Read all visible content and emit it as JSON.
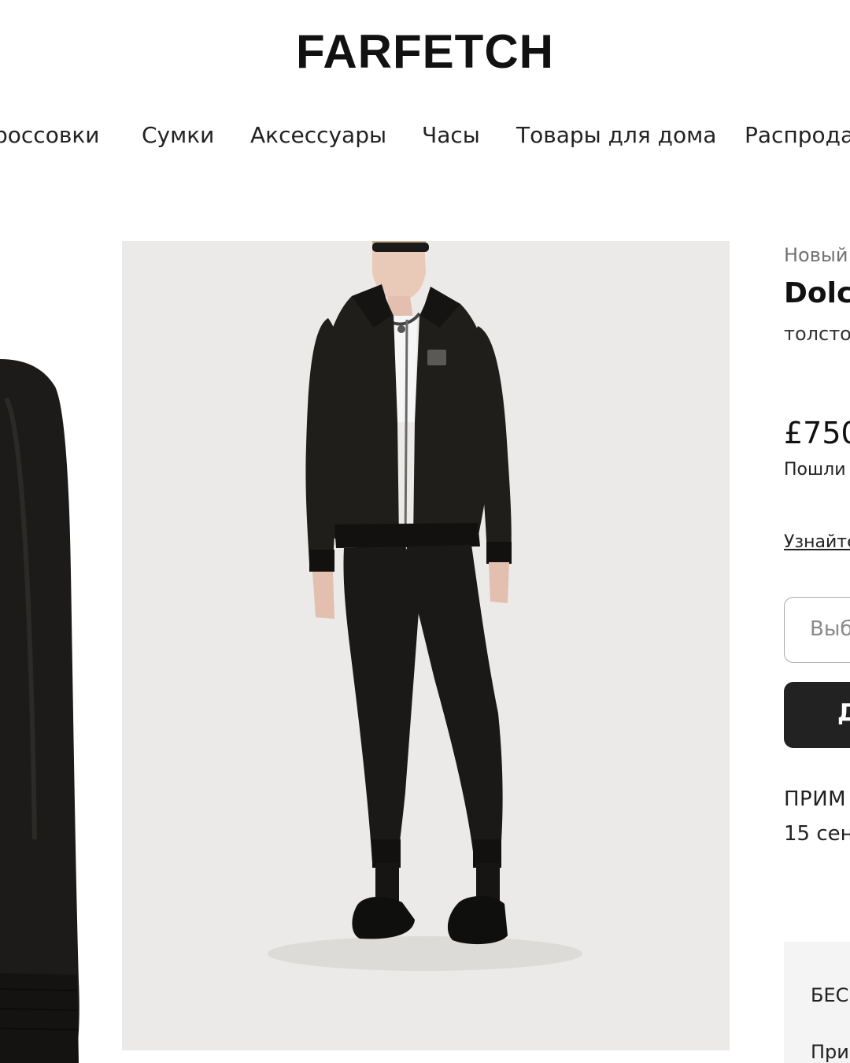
{
  "header": {
    "logo": "FARFETCH"
  },
  "nav": {
    "items": [
      {
        "label": "россовки"
      },
      {
        "label": "Сумки"
      },
      {
        "label": "Аксессуары"
      },
      {
        "label": "Часы"
      },
      {
        "label": "Товары для дома"
      },
      {
        "label": "Распрода"
      }
    ]
  },
  "product": {
    "badge": "Новый",
    "brand": "Dolc",
    "description": "толсто",
    "price": "£750",
    "duties_note": "Пошли",
    "learn_more": "Узнайте",
    "size_placeholder": "Выб",
    "add_button": "Д",
    "delivery_title": "ПРИМ",
    "delivery_date": "15 сен",
    "promo_title": "БЕС",
    "promo_text": "При"
  },
  "colors": {
    "primary_button": "#222222",
    "image_background": "#ebeae8",
    "garment": "#1c1b19",
    "muted_text": "#727272"
  }
}
